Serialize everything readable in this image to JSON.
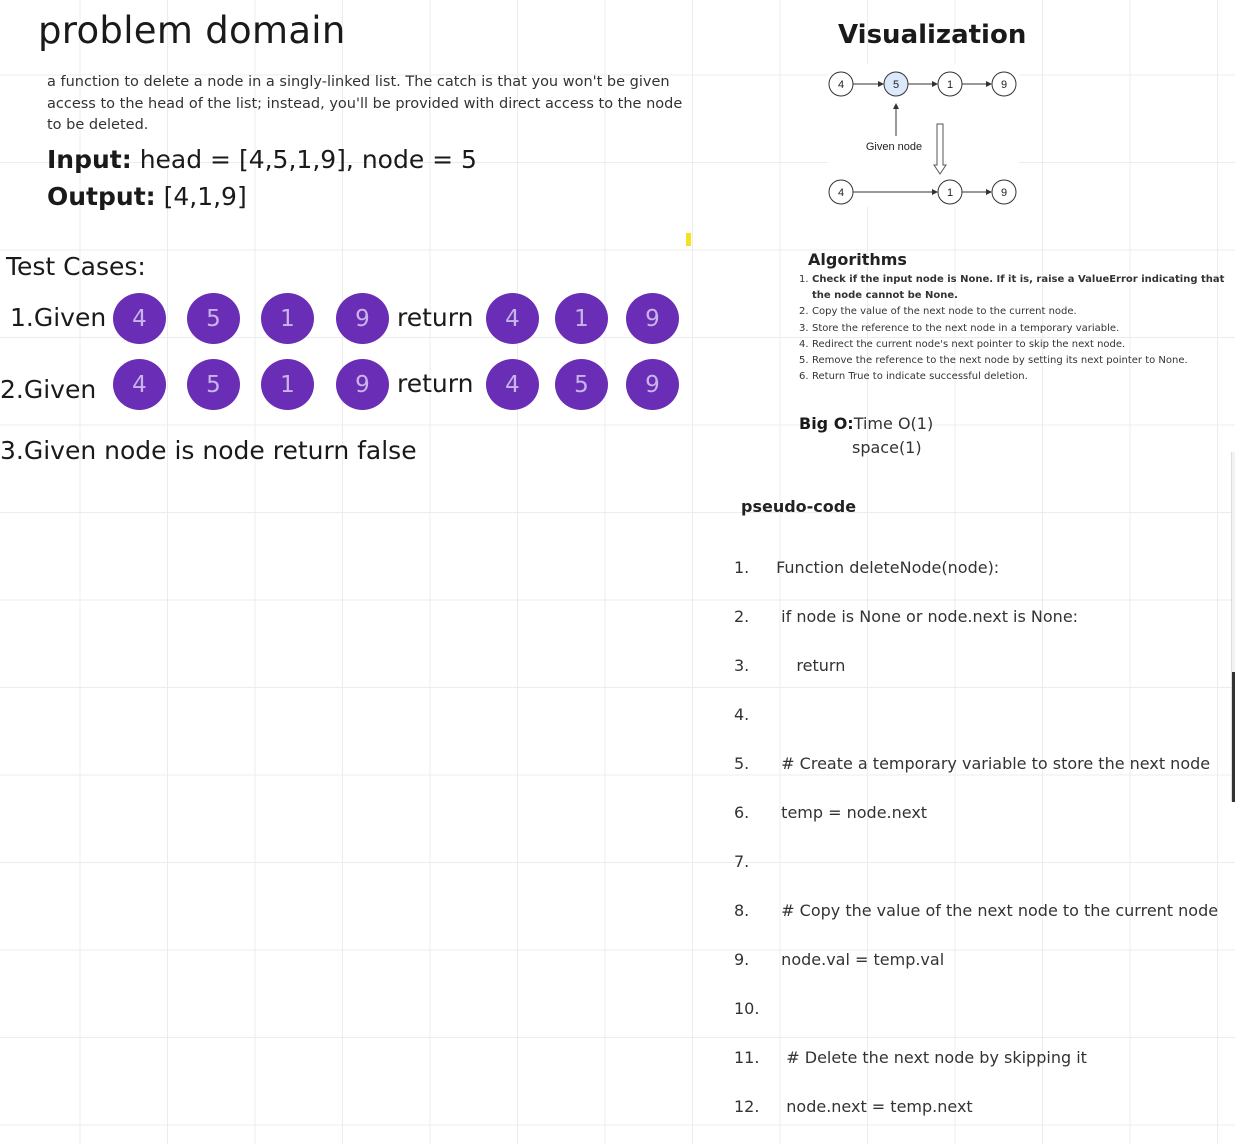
{
  "problem": {
    "title": "problem domain",
    "description": "a function to delete a node in a singly-linked list. The catch is that you won't be given access to the head of the list; instead, you'll be provided with direct access to the node to be deleted.",
    "input_label": "Input:",
    "input_value": " head = [4,5,1,9], node = 5",
    "output_label": "Output:",
    "output_value": " [4,1,9]"
  },
  "tests": {
    "title": "Test Cases:",
    "case1": {
      "label": "1.Given",
      "given": [
        "4",
        "5",
        "1",
        "9"
      ],
      "word": "return",
      "result": [
        "4",
        "1",
        "9"
      ]
    },
    "case2": {
      "label": "2.Given",
      "given": [
        "4",
        "5",
        "1",
        "9"
      ],
      "word": "return",
      "result": [
        "4",
        "5",
        "9"
      ]
    },
    "case3": "3.Given node is node return false"
  },
  "visualization": {
    "title": "Visualization",
    "top_nodes": [
      "4",
      "5",
      "1",
      "9"
    ],
    "bottom_nodes": [
      "4",
      "1",
      "9"
    ],
    "given_label": "Given node",
    "highlight_color": "#dbe9fb"
  },
  "algorithms": {
    "title": "Algorithms",
    "steps": [
      {
        "num": "1.",
        "text": "Check if the input node is None. If it is, raise a ValueError indicating that the node cannot be None."
      },
      {
        "num": "2.",
        "text": "Copy the value of the next node to the current node."
      },
      {
        "num": "3.",
        "text": "Store the reference to the next node in a temporary variable."
      },
      {
        "num": "4.",
        "text": "Redirect the current node's next pointer to skip the next node."
      },
      {
        "num": "5.",
        "text": "Remove the reference to the next node by setting its next pointer to None."
      },
      {
        "num": "6.",
        "text": "Return True to indicate successful deletion."
      }
    ]
  },
  "bigo": {
    "label": "Big O:",
    "time": "Time O(1)",
    "space": "space(1)"
  },
  "pseudocode": {
    "title": "pseudo-code",
    "lines": [
      {
        "num": "1.",
        "code": " Function deleteNode(node):"
      },
      {
        "num": "2.",
        "code": "  if node is None or node.next is None:"
      },
      {
        "num": "3.",
        "code": "     return"
      },
      {
        "num": "4.",
        "code": ""
      },
      {
        "num": "5.",
        "code": "  # Create a temporary variable to store the next node"
      },
      {
        "num": "6.",
        "code": "  temp = node.next"
      },
      {
        "num": "7.",
        "code": ""
      },
      {
        "num": "8.",
        "code": "  # Copy the value of the next node to the current node"
      },
      {
        "num": "9.",
        "code": "  node.val = temp.val"
      },
      {
        "num": "10.",
        "code": ""
      },
      {
        "num": "11.",
        "code": "   # Delete the next node by skipping it"
      },
      {
        "num": "12.",
        "code": "   node.next = temp.next"
      }
    ]
  },
  "colors": {
    "circle": "#6a2db5",
    "circle_text": "#c9b4ea",
    "marker": "#f5e021"
  }
}
